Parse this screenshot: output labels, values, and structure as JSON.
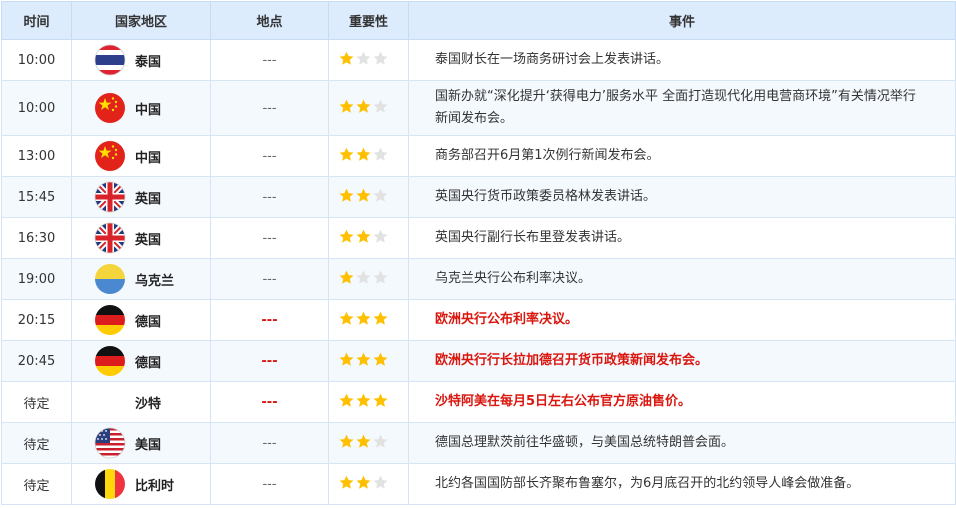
{
  "headers": {
    "time": "时间",
    "country": "国家地区",
    "place": "地点",
    "importance": "重要性",
    "event": "事件"
  },
  "colors": {
    "star_on": "#ffc000",
    "star_off": "#e2e2e2",
    "highlight": "#d9170e",
    "header_bg": "#dcecfd"
  },
  "events": [
    {
      "time": "10:00",
      "country": "泰国",
      "flag": "thailand-flag-icon",
      "place": "---",
      "stars": 1,
      "text": "泰国财长在一场商务研讨会上发表讲话。",
      "high": false
    },
    {
      "time": "10:00",
      "country": "中国",
      "flag": "china-flag-icon",
      "place": "---",
      "stars": 2,
      "text": "国新办就“深化提升‘获得电力’服务水平 全面打造现代化用电营商环境”有关情况举行新闻发布会。",
      "high": false
    },
    {
      "time": "13:00",
      "country": "中国",
      "flag": "china-flag-icon",
      "place": "---",
      "stars": 2,
      "text": "商务部召开6月第1次例行新闻发布会。",
      "high": false
    },
    {
      "time": "15:45",
      "country": "英国",
      "flag": "uk-flag-icon",
      "place": "---",
      "stars": 2,
      "text": "英国央行货币政策委员格林发表讲话。",
      "high": false
    },
    {
      "time": "16:30",
      "country": "英国",
      "flag": "uk-flag-icon",
      "place": "---",
      "stars": 2,
      "text": "英国央行副行长布里登发表讲话。",
      "high": false
    },
    {
      "time": "19:00",
      "country": "乌克兰",
      "flag": "ukraine-flag-icon",
      "place": "---",
      "stars": 1,
      "text": "乌克兰央行公布利率决议。",
      "high": false
    },
    {
      "time": "20:15",
      "country": "德国",
      "flag": "germany-flag-icon",
      "place": "---",
      "stars": 3,
      "text": "欧洲央行公布利率决议。",
      "high": true
    },
    {
      "time": "20:45",
      "country": "德国",
      "flag": "germany-flag-icon",
      "place": "---",
      "stars": 3,
      "text": "欧洲央行行长拉加德召开货币政策新闻发布会。",
      "high": true
    },
    {
      "time": "待定",
      "country": "沙特",
      "flag": "",
      "place": "---",
      "stars": 3,
      "text": "沙特阿美在每月5日左右公布官方原油售价。",
      "high": true
    },
    {
      "time": "待定",
      "country": "美国",
      "flag": "usa-flag-icon",
      "place": "---",
      "stars": 2,
      "text": "德国总理默茨前往华盛顿，与美国总统特朗普会面。",
      "high": false
    },
    {
      "time": "待定",
      "country": "比利时",
      "flag": "belgium-flag-icon",
      "place": "---",
      "stars": 2,
      "text": "北约各国国防部长齐聚布鲁塞尔，为6月底召开的北约领导人峰会做准备。",
      "high": false
    }
  ]
}
